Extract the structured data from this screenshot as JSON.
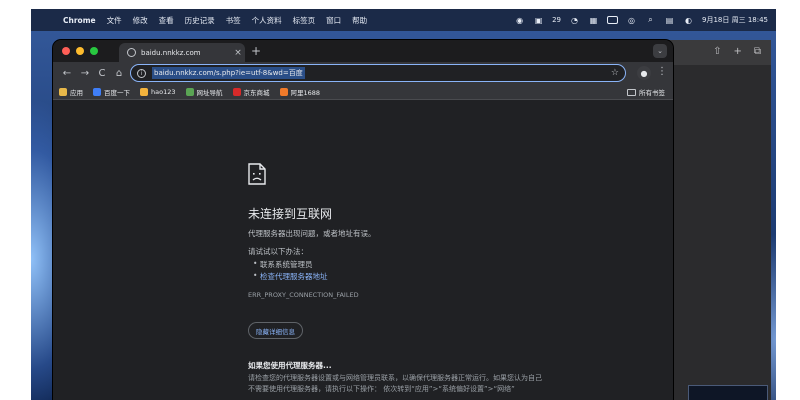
{
  "menubar": {
    "apple_glyph": "",
    "app_name": "Chrome",
    "items": [
      "文件",
      "修改",
      "查看",
      "历史记录",
      "书签",
      "个人资料",
      "标签页",
      "窗口",
      "帮助"
    ],
    "status": {
      "badge_count": "29",
      "datetime": "9月18日 周三  18:45"
    }
  },
  "tab": {
    "title": "baidu.nnkkz.com",
    "close_glyph": "×",
    "new_tab_glyph": "+",
    "search_glyph": "⌄"
  },
  "toolbar": {
    "back_glyph": "←",
    "forward_glyph": "→",
    "reload_glyph": "C",
    "home_glyph": "⌂",
    "url": "baidu.nnkkz.com/s.php?ie=utf-8&wd=百度",
    "info_glyph": "i",
    "star_glyph": "☆",
    "menu_glyph": "⋮"
  },
  "bookmarks": {
    "items": [
      {
        "label": "应用",
        "color": "#e8b84a"
      },
      {
        "label": "百度一下",
        "color": "#3f7ef7"
      },
      {
        "label": "hao123",
        "color": "#f3b33d"
      },
      {
        "label": "网址导航",
        "color": "#5aa454"
      },
      {
        "label": "京东商城",
        "color": "#d62a2a"
      },
      {
        "label": "阿里1688",
        "color": "#f07a2a"
      }
    ],
    "all_bookmarks": "所有书签"
  },
  "error_page": {
    "title": "未连接到互联网",
    "description": "代理服务器出现问题，或者地址有误。",
    "try_label": "请试试以下办法：",
    "suggestions": [
      "联系系统管理员",
      "检查代理服务器地址"
    ],
    "error_code": "ERR_PROXY_CONNECTION_FAILED",
    "details_button": "隐藏详细信息",
    "proxy_heading": "如果您使用代理服务器...",
    "proxy_text": "请检查您的代理服务器设置或与网络管理员联系，以确保代理服务器正常运行。如果您认为自己不需要使用代理服务器，请执行以下操作： 依次转到“应用”>“系统偏好设置”>“网络”"
  },
  "background_window": {
    "share_glyph": "⇧",
    "plus_glyph": "+",
    "tabs_glyph": "⧉"
  }
}
